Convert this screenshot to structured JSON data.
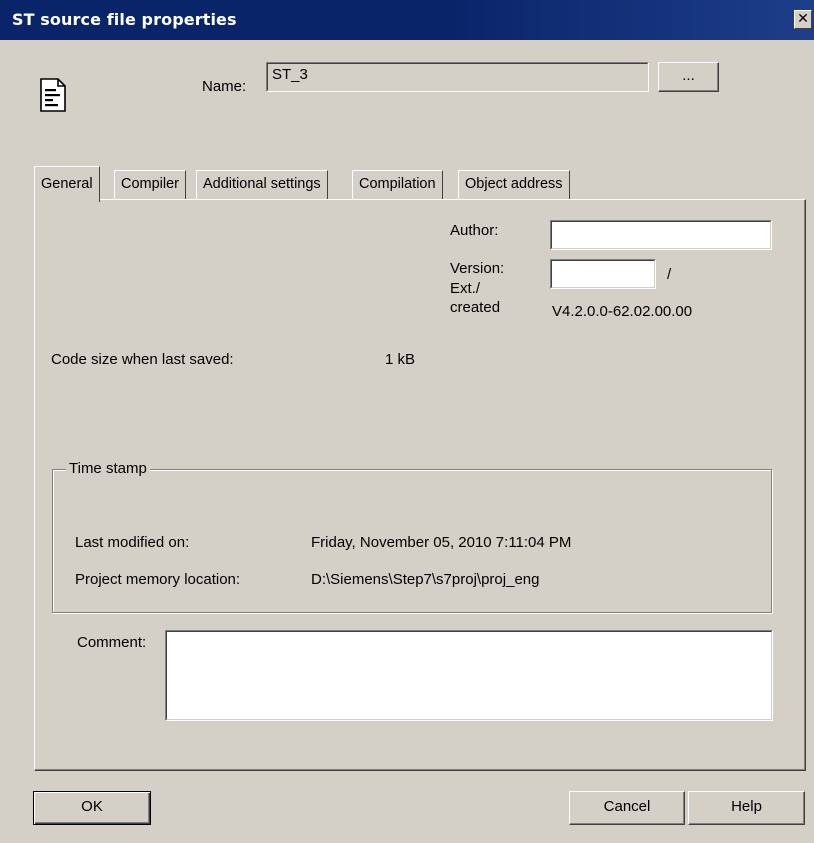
{
  "window": {
    "title": "ST source file properties",
    "close_label": "✕"
  },
  "header": {
    "name_label": "Name:",
    "name_value": "ST_3",
    "browse_label": "...",
    "icon": "document-icon"
  },
  "tabs": [
    {
      "label": "General",
      "active": true
    },
    {
      "label": "Compiler"
    },
    {
      "label": "Additional settings"
    },
    {
      "label": "Compilation"
    },
    {
      "label": "Object address"
    }
  ],
  "general": {
    "author_label": "Author:",
    "author_value": "",
    "version_label": "Version:",
    "version_value": "",
    "version_separator": "/",
    "ext_created_label_1": "Ext./",
    "ext_created_label_2": "created",
    "ext_created_value": "V4.2.0.0-62.02.00.00",
    "code_size_label": "Code size when last saved:",
    "code_size_value": "1 kB",
    "timestamp": {
      "legend": "Time stamp",
      "last_modified_label": "Last modified on:",
      "last_modified_value": "Friday, November 05, 2010 7:11:04 PM",
      "memory_location_label": "Project memory location:",
      "memory_location_value": "D:\\Siemens\\Step7\\s7proj\\proj_eng"
    },
    "comment_label": "Comment:",
    "comment_value": ""
  },
  "buttons": {
    "ok": "OK",
    "cancel": "Cancel",
    "help": "Help"
  }
}
